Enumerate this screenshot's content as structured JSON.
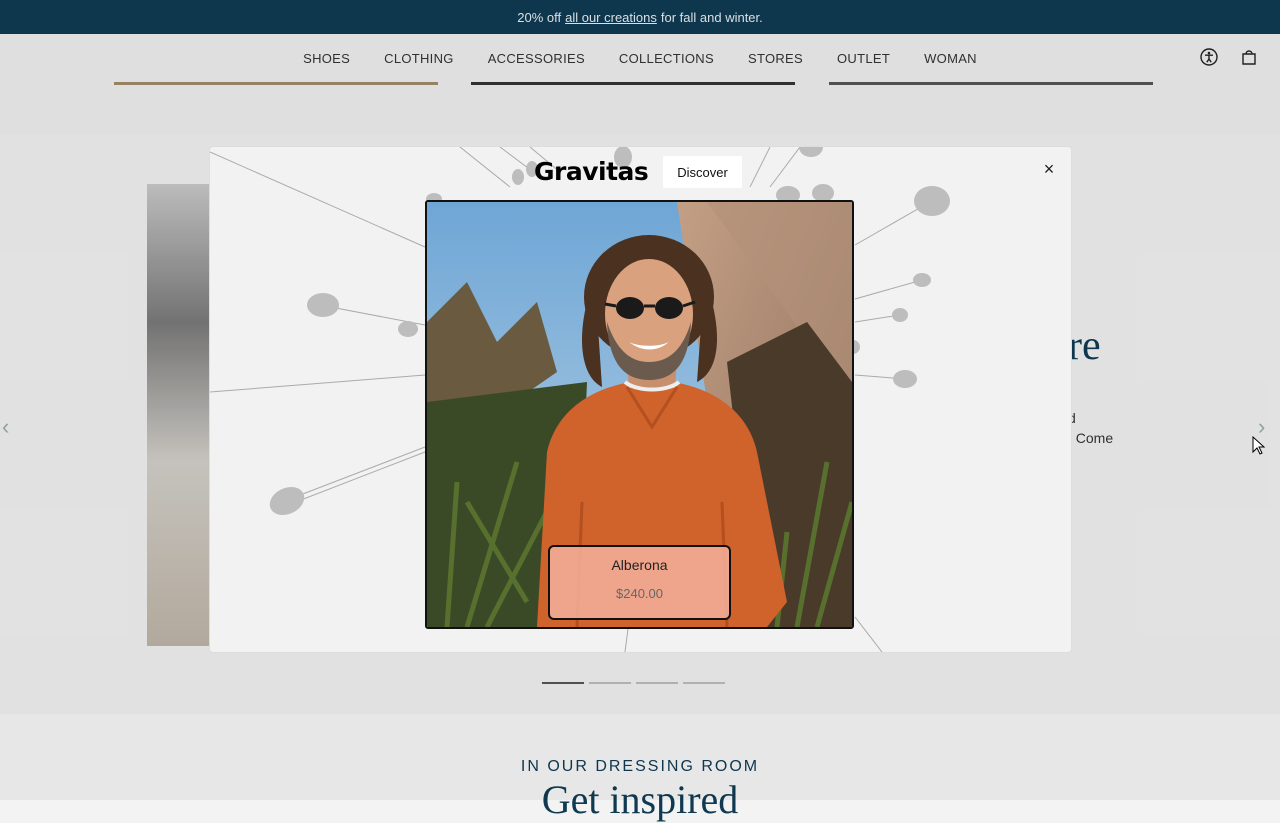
{
  "announcement": {
    "prefix": "20% off",
    "link": "all our creations",
    "suffix": "for fall and winter."
  },
  "nav": {
    "items": [
      "SHOES",
      "CLOTHING",
      "ACCESSORIES",
      "COLLECTIONS",
      "STORES",
      "OUTLET",
      "WOMAN"
    ]
  },
  "header_icons": [
    "accessibility-icon",
    "cart-icon"
  ],
  "hero": {
    "title_fragment": "re",
    "text_fragment_1": "d",
    "text_fragment_2": ". Come",
    "slides_count": 4,
    "active_slide": 1
  },
  "below": {
    "eyebrow": "IN OUR DRESSING ROOM",
    "heading": "Get inspired"
  },
  "modal": {
    "brand": "Gravitas",
    "discover_label": "Discover",
    "close_label": "×",
    "product": {
      "name": "Alberona",
      "price": "$240.00"
    }
  },
  "colors": {
    "brand_navy": "#0f3a52",
    "sweater_orange": "#d0622c",
    "card_tint": "#f5b4a0"
  }
}
